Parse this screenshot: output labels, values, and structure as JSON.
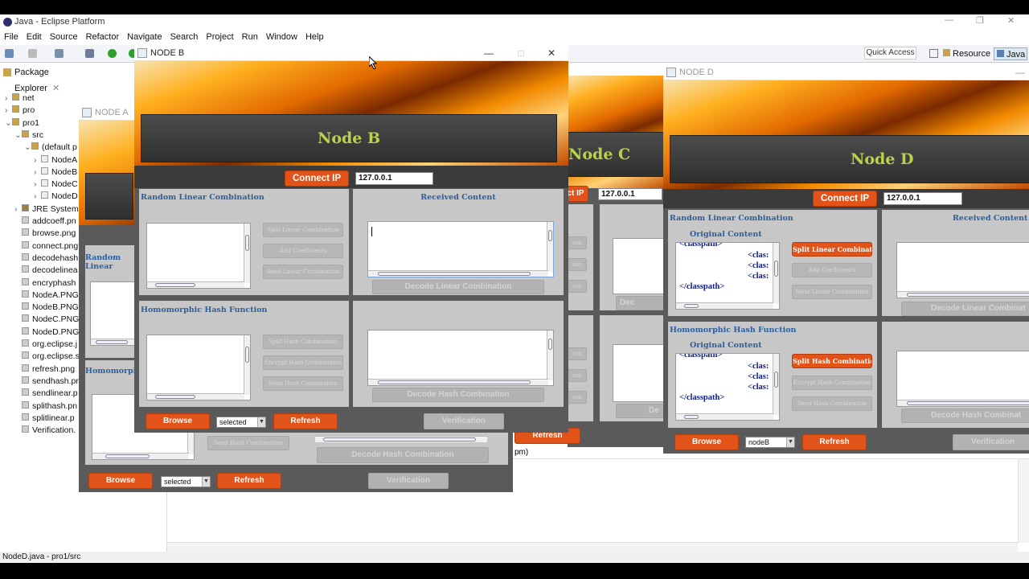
{
  "eclipse": {
    "title": "Java - Eclipse Platform",
    "menu": [
      "File",
      "Edit",
      "Source",
      "Refactor",
      "Navigate",
      "Search",
      "Project",
      "Run",
      "Window",
      "Help"
    ],
    "quick_access": "Quick Access",
    "perspectives": [
      "Resource",
      "Java"
    ],
    "status": "NodeD.java - pro1/src",
    "console_fragment": "pm)"
  },
  "package_explorer": {
    "title": "Package Explorer",
    "items": [
      {
        "label": "net"
      },
      {
        "label": "pro"
      },
      {
        "label": "pro1"
      },
      {
        "label": "src"
      },
      {
        "label": "(default p"
      },
      {
        "label": "NodeA"
      },
      {
        "label": "NodeB"
      },
      {
        "label": "NodeC"
      },
      {
        "label": "NodeD"
      },
      {
        "label": "JRE System"
      },
      {
        "label": "addcoeff.pn"
      },
      {
        "label": "browse.png"
      },
      {
        "label": "connect.png"
      },
      {
        "label": "decodehash"
      },
      {
        "label": "decodelinea"
      },
      {
        "label": "encryphash"
      },
      {
        "label": "NodeA.PNG"
      },
      {
        "label": "NodeB.PNG"
      },
      {
        "label": "NodeC.PNG"
      },
      {
        "label": "NodeD.PNG"
      },
      {
        "label": "org.eclipse.j"
      },
      {
        "label": "org.eclipse.s"
      },
      {
        "label": "refresh.png"
      },
      {
        "label": "sendhash.pr"
      },
      {
        "label": "sendlinear.p"
      },
      {
        "label": "splithash.pn"
      },
      {
        "label": "splitlinear.p"
      },
      {
        "label": "Verification."
      }
    ]
  },
  "nodeA": {
    "title": "NODE A",
    "random_linear": "Random Linear",
    "homomorphic": "Homomorphic",
    "send_hash": "Send Hash Combination",
    "decode_hash": "Decode Hash Combination",
    "browse": "Browse",
    "select_value": "selected",
    "refresh": "Refresh",
    "verification": "Verification"
  },
  "nodeB": {
    "title": "NODE B",
    "heading": "Node B",
    "connect": "Connect IP",
    "ip": "127.0.0.1",
    "random_linear": "Random Linear Combination",
    "received": "Received Content",
    "split_linear": "Split Linear Combination",
    "add_coeff": "Add Coefficients",
    "send_linear": "Send Linear Combination",
    "decode_linear": "Decode Linear Combination",
    "homomorphic": "Homomorphic Hash Function",
    "split_hash": "Split Hash Combination",
    "encrypt_hash": "Encrypt Hash Combination",
    "send_hash": "Send Hash Combination",
    "decode_hash": "Decode Hash Combination",
    "browse": "Browse",
    "select_value": "selected",
    "refresh": "Refresh",
    "verification": "Verification"
  },
  "nodeC": {
    "heading": "Node C",
    "connect_fragment": "ct IP",
    "ip": "127.0.0.1",
    "decode_fragment": "Dec",
    "decode_hash_fragment": "De",
    "refresh": "Refresh",
    "btn_fragments": [
      "ion",
      "ion",
      "ion",
      "ion",
      "ion",
      "ion"
    ]
  },
  "nodeD": {
    "title": "NODE D",
    "heading": "Node D",
    "connect": "Connect IP",
    "ip": "127.0.0.1",
    "random_linear": "Random Linear Combination",
    "original": "Original Content",
    "received": "Received Content",
    "split_linear": "Split Linear Combination",
    "add_coeff": "Add Coefficients",
    "send_linear": "Send Linear Combination",
    "decode_linear": "Decode Linear Combinat",
    "homomorphic": "Homomorphic Hash Function",
    "original2": "Original Content",
    "split_hash": "Split Hash Combination",
    "encrypt_hash": "Encrypt Hash Combination",
    "send_hash": "Send Hash Combination",
    "decode_hash": "Decode Hash Combinat",
    "browse": "Browse",
    "select_value": "nodeB",
    "refresh": "Refresh",
    "verification": "Verification",
    "code_lines": [
      "<classpath>",
      "<clas:",
      "<clas:",
      "<clas:",
      "</classpath>"
    ]
  }
}
